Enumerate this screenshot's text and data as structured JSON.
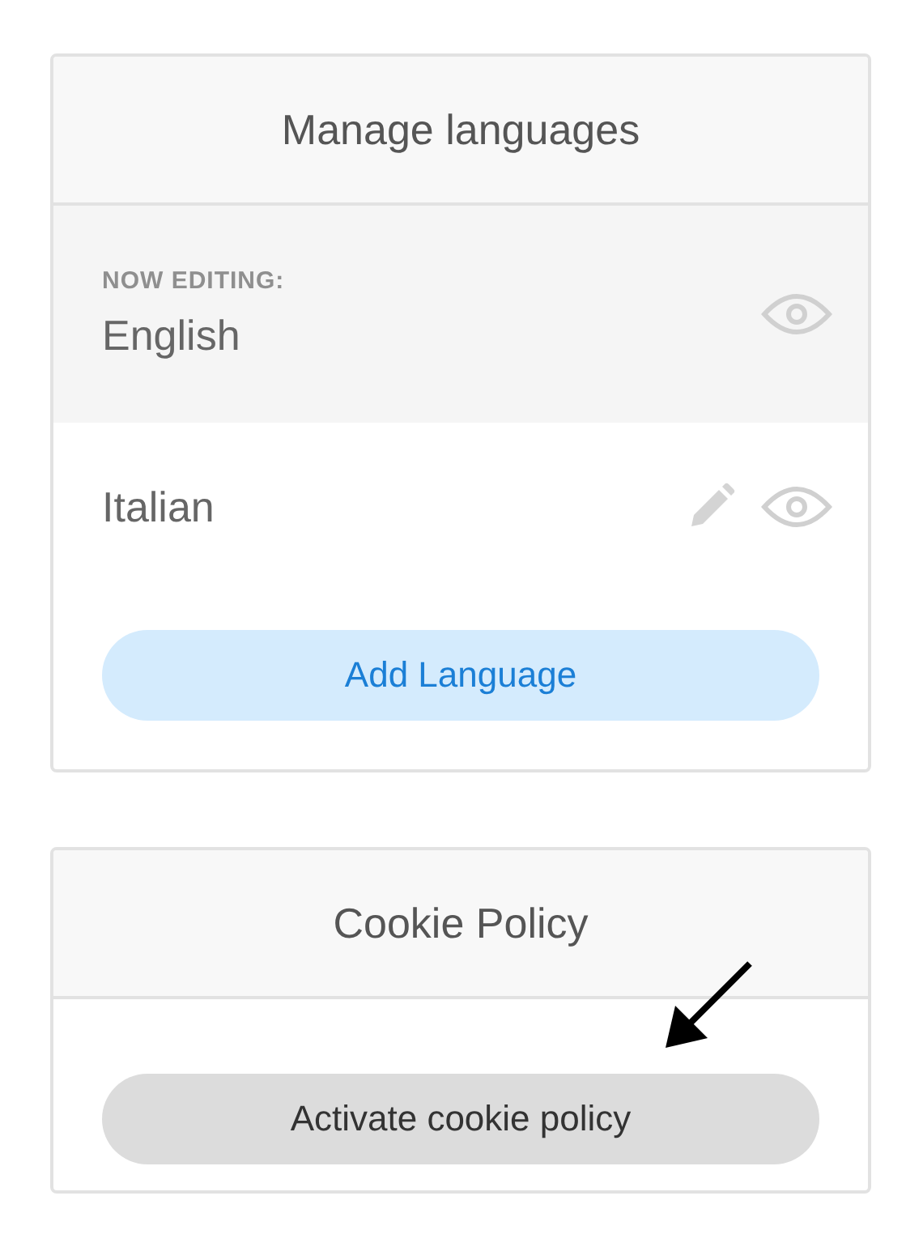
{
  "languages_panel": {
    "title": "Manage languages",
    "editing_label": "NOW EDITING:",
    "languages": [
      {
        "name": "English",
        "editing": true
      },
      {
        "name": "Italian",
        "editing": false
      }
    ],
    "add_button": "Add Language"
  },
  "cookie_panel": {
    "title": "Cookie Policy",
    "button": "Activate cookie policy"
  }
}
